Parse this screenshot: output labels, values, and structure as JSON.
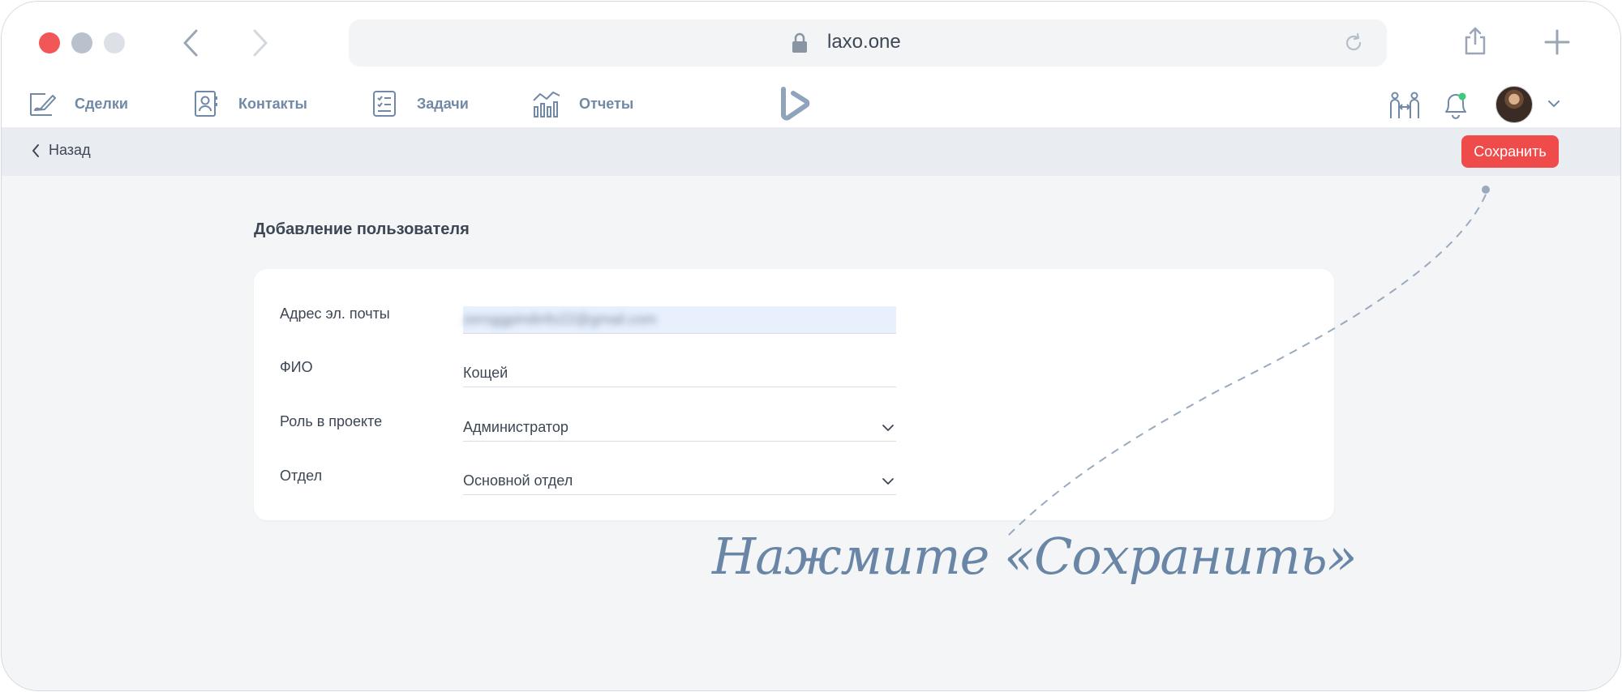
{
  "browser": {
    "url": "laxo.one",
    "icons": {
      "back": "chevron-left-icon",
      "forward": "chevron-right-icon",
      "lock": "lock-icon",
      "reload": "reload-icon",
      "share": "share-icon",
      "new_tab": "plus-icon"
    }
  },
  "nav": {
    "items": [
      {
        "label": "Сделки",
        "icon": "deals-icon"
      },
      {
        "label": "Контакты",
        "icon": "contacts-icon"
      },
      {
        "label": "Задачи",
        "icon": "tasks-icon"
      },
      {
        "label": "Отчеты",
        "icon": "reports-icon"
      }
    ],
    "right_icons": [
      "team-icon",
      "bell-icon",
      "avatar",
      "chevron-down-icon"
    ],
    "notification_dot_color": "#3ec97b"
  },
  "actionbar": {
    "back_label": "Назад",
    "save_label": "Сохранить"
  },
  "page": {
    "title": "Добавление пользователя"
  },
  "form": {
    "email": {
      "label": "Адрес эл. почты",
      "value": "zeroggpindinfo22@gmail.com"
    },
    "name": {
      "label": "ФИО",
      "value": "Кощей"
    },
    "role": {
      "label": "Роль в проекте",
      "value": "Администратор"
    },
    "department": {
      "label": "Отдел",
      "value": "Основной отдел"
    }
  },
  "annotation": {
    "text": "Нажмите «Сохранить»"
  },
  "colors": {
    "accent_red": "#f04b4b",
    "nav_text": "#7189a6",
    "annotation": "#6a86a6",
    "background": "#f4f5f7"
  }
}
